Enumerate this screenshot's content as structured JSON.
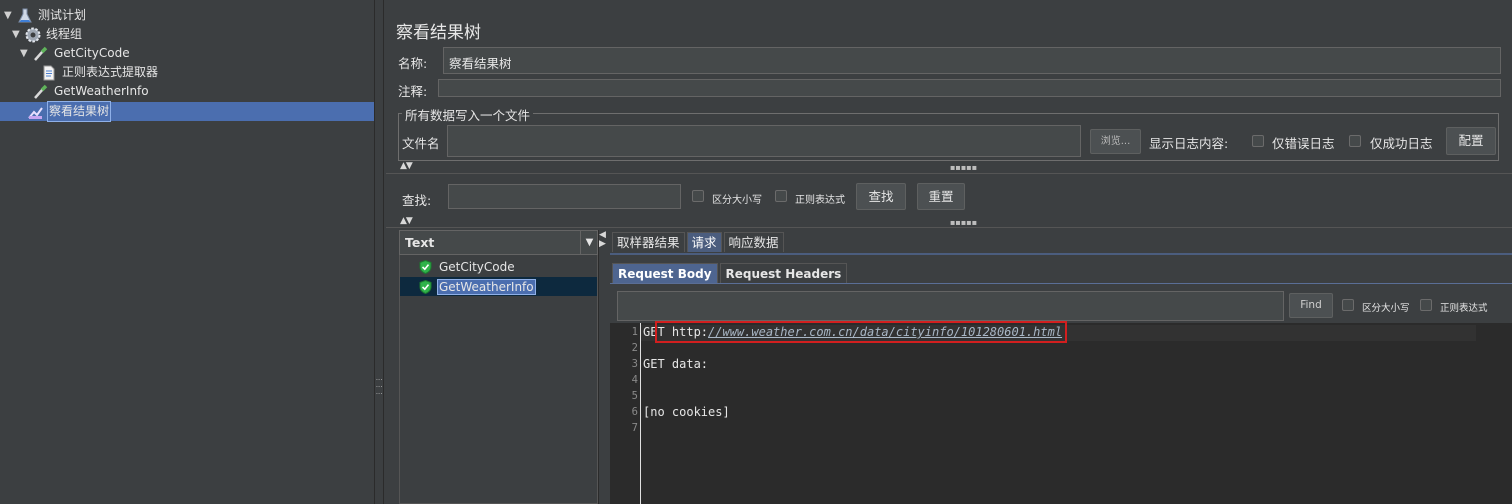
{
  "tree": {
    "items": [
      {
        "label": "测试计划",
        "icon": "flask-icon",
        "level": 0,
        "expanded": true
      },
      {
        "label": "线程组",
        "icon": "gear-icon",
        "level": 1,
        "expanded": true
      },
      {
        "label": "GetCityCode",
        "icon": "pipette-icon",
        "level": 2,
        "expanded": true
      },
      {
        "label": "正则表达式提取器",
        "icon": "document-icon",
        "level": 3
      },
      {
        "label": "GetWeatherInfo",
        "icon": "pipette-icon",
        "level": 2
      },
      {
        "label": "察看结果树",
        "icon": "chart-icon",
        "level": 2,
        "selected": true
      }
    ]
  },
  "panel": {
    "title": "察看结果树",
    "name_label": "名称:",
    "name_value": "察看结果树",
    "comment_label": "注释:",
    "comment_value": "",
    "file_group_title": "所有数据写入一个文件",
    "filename_label": "文件名",
    "filename_value": "",
    "browse_label": "浏览...",
    "log_display_label": "显示日志内容:",
    "errors_only_label": "仅错误日志",
    "success_only_label": "仅成功日志",
    "configure_label": "配置"
  },
  "search": {
    "label": "查找:",
    "value": "",
    "case_sensitive_label": "区分大小写",
    "regex_label": "正则表达式",
    "find_label": "查找",
    "reset_label": "重置"
  },
  "results": {
    "renderer": "Text",
    "samples": [
      {
        "label": "GetCityCode",
        "status": "success"
      },
      {
        "label": "GetWeatherInfo",
        "status": "success",
        "selected": true
      }
    ]
  },
  "detail": {
    "tabs": [
      "取样器结果",
      "请求",
      "响应数据"
    ],
    "active_tab": "请求",
    "subtabs": [
      "Request Body",
      "Request Headers"
    ],
    "active_subtab": "Request Body",
    "find_label": "Find",
    "case_sensitive_label": "区分大小写",
    "regex_label": "正则表达式",
    "lines": [
      {
        "n": "1",
        "method": "GET ",
        "scheme": "http:",
        "url": "//www.weather.com.cn/data/cityinfo/101280601.html"
      },
      {
        "n": "2",
        "text": ""
      },
      {
        "n": "3",
        "text": "GET data:"
      },
      {
        "n": "4",
        "text": ""
      },
      {
        "n": "5",
        "text": ""
      },
      {
        "n": "6",
        "text": "[no cookies]"
      },
      {
        "n": "7",
        "text": ""
      }
    ]
  },
  "colors": {
    "background": "#3c3f41",
    "selection": "#4b6eaf",
    "highlight_box": "#d21f1f",
    "success_icon": "#2fb34a"
  }
}
